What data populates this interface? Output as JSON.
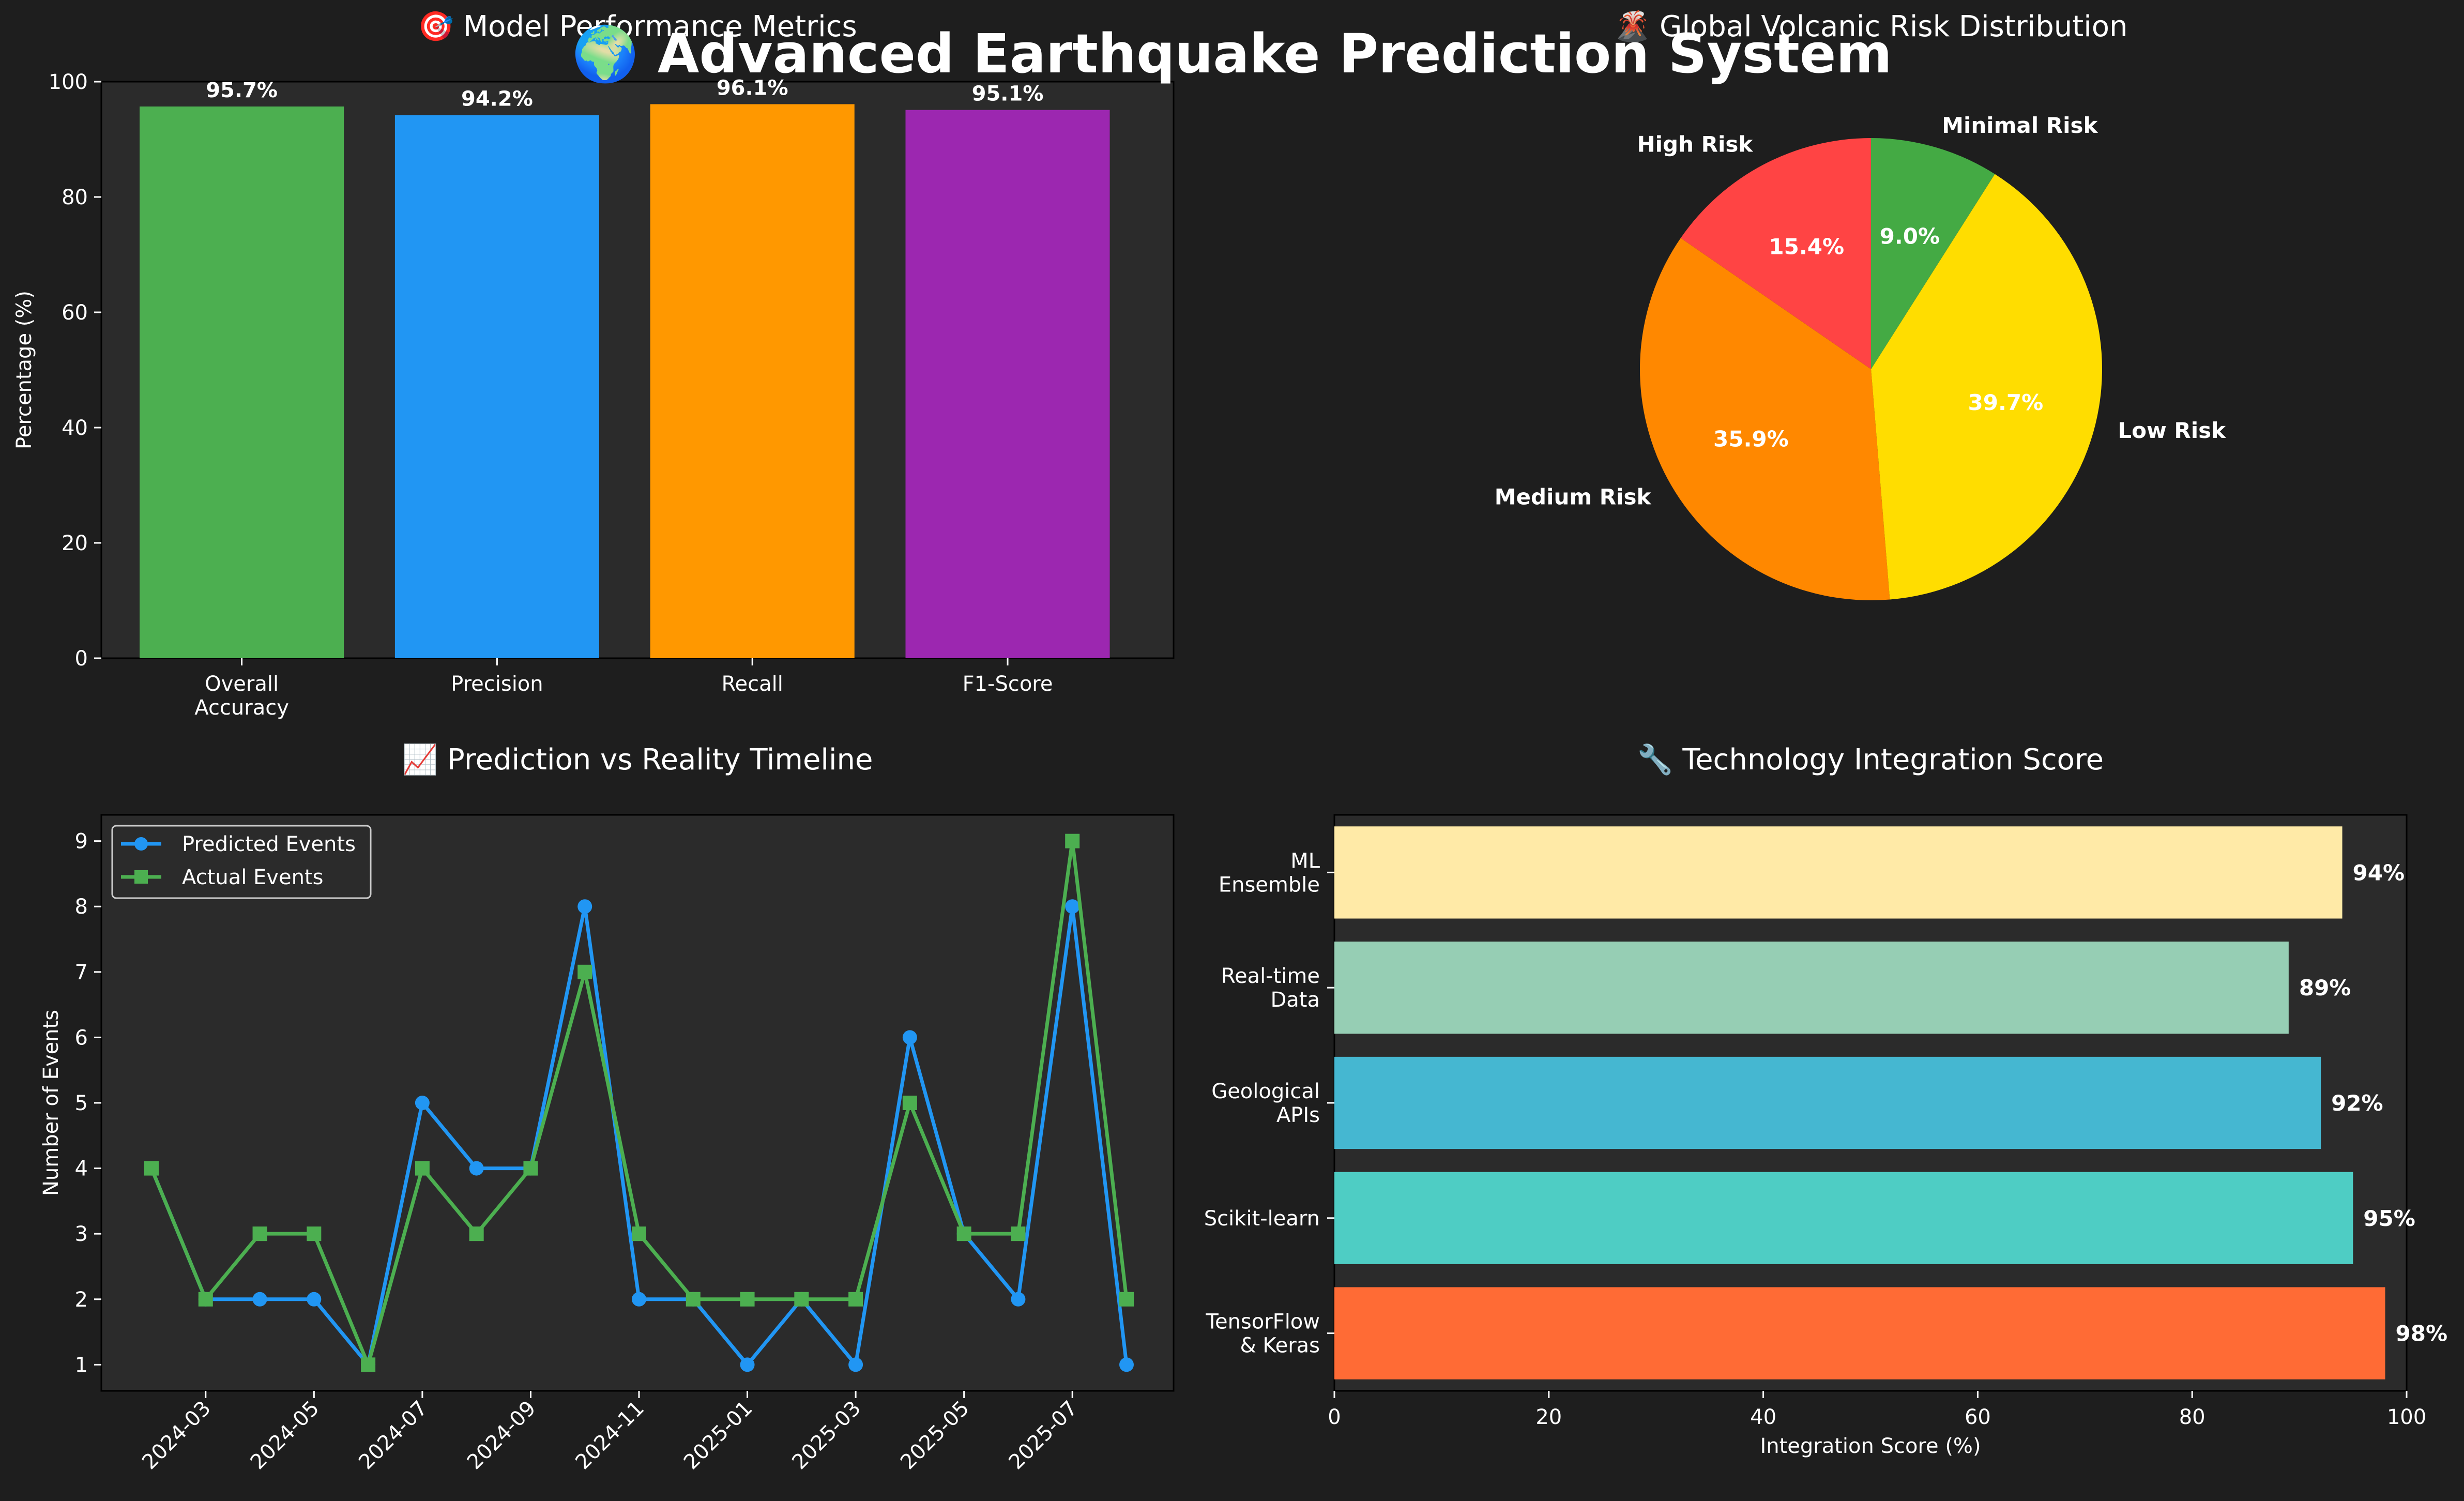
{
  "suptitle": "🌍 Advanced Earthquake Prediction System",
  "colors": {
    "background": "#1e1e1e",
    "panel": "#2b2b2b",
    "text": "#ffffff"
  },
  "chart_data": [
    {
      "type": "bar",
      "title": "🎯 Model Performance Metrics",
      "ylabel": "Percentage (%)",
      "xlabel": "",
      "ylim": [
        0,
        100
      ],
      "yticks": [
        0,
        20,
        40,
        60,
        80,
        100
      ],
      "categories": [
        "Overall\nAccuracy",
        "Precision",
        "Recall",
        "F1-Score"
      ],
      "values": [
        95.7,
        94.2,
        96.1,
        95.1
      ],
      "value_labels": [
        "95.7%",
        "94.2%",
        "96.1%",
        "95.1%"
      ],
      "colors": [
        "#4caf50",
        "#2196f3",
        "#ff9800",
        "#9c27b0"
      ],
      "grid": false
    },
    {
      "type": "pie",
      "title": "🌋 Global Volcanic Risk Distribution",
      "labels": [
        "High Risk",
        "Medium Risk",
        "Low Risk",
        "Minimal Risk"
      ],
      "values": [
        15.4,
        35.9,
        39.7,
        9.0
      ],
      "pct_labels": [
        "15.4%",
        "35.9%",
        "39.7%",
        "9.0%"
      ],
      "colors": [
        "#ff4444",
        "#ff8800",
        "#ffdd00",
        "#44aa44"
      ],
      "start_angle_deg": 90,
      "direction": "counterclockwise"
    },
    {
      "type": "line",
      "title": "📈 Prediction vs Reality Timeline",
      "ylabel": "Number of Events",
      "xlabel": "",
      "x": [
        "2024-02",
        "2024-03",
        "2024-04",
        "2024-05",
        "2024-06",
        "2024-07",
        "2024-08",
        "2024-09",
        "2024-10",
        "2024-11",
        "2024-12",
        "2025-01",
        "2025-02",
        "2025-03",
        "2025-04",
        "2025-05",
        "2025-06",
        "2025-07",
        "2025-08"
      ],
      "xticks": [
        "2024-03",
        "2024-05",
        "2024-07",
        "2024-09",
        "2024-11",
        "2025-01",
        "2025-03",
        "2025-05",
        "2025-07"
      ],
      "ylim": [
        0.6,
        9.4
      ],
      "yticks": [
        1,
        2,
        3,
        4,
        5,
        6,
        7,
        8,
        9
      ],
      "series": [
        {
          "name": "Predicted Events",
          "color": "#2196f3",
          "marker": "circle",
          "values": [
            4,
            2,
            2,
            2,
            1,
            5,
            4,
            4,
            8,
            2,
            2,
            1,
            2,
            1,
            6,
            3,
            2,
            8,
            1
          ]
        },
        {
          "name": "Actual Events",
          "color": "#4caf50",
          "marker": "square",
          "values": [
            4,
            2,
            3,
            3,
            1,
            4,
            3,
            4,
            7,
            3,
            2,
            2,
            2,
            2,
            5,
            3,
            3,
            9,
            2
          ]
        }
      ],
      "legend": "top-left",
      "grid": false
    },
    {
      "type": "bar",
      "orientation": "horizontal",
      "title": "🔧 Technology Integration Score",
      "xlabel": "Integration Score (%)",
      "ylabel": "",
      "xlim": [
        0,
        100
      ],
      "xticks": [
        0,
        20,
        40,
        60,
        80,
        100
      ],
      "categories": [
        "TensorFlow\n& Keras",
        "Scikit-learn",
        "Geological\nAPIs",
        "Real-time\nData",
        "ML\nEnsemble"
      ],
      "values": [
        98,
        95,
        92,
        89,
        94
      ],
      "value_labels": [
        "98%",
        "95%",
        "92%",
        "89%",
        "94%"
      ],
      "colors": [
        "#ff6b35",
        "#4ecdc4",
        "#45b7d1",
        "#96ceb4",
        "#ffeaa7"
      ],
      "grid": false
    }
  ]
}
